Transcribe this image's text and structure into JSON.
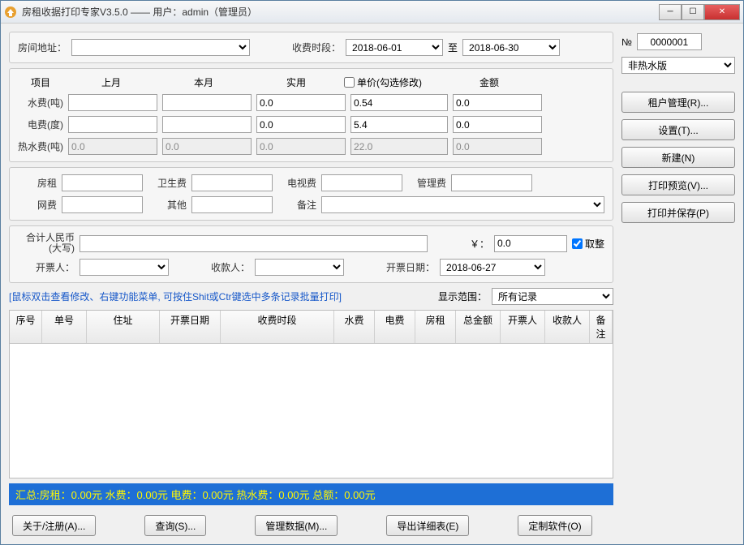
{
  "window": {
    "title": "房租收据打印专家V3.5.0 —— 用户：admin（管理员）"
  },
  "number": {
    "label": "№",
    "value": "0000001"
  },
  "address": {
    "label": "房间地址："
  },
  "period": {
    "label": "收费时段：",
    "from": "2018-06-01",
    "to_label": "至",
    "to": "2018-06-30"
  },
  "version_select": "非热水版",
  "cols": {
    "project": "项目",
    "last": "上月",
    "this": "本月",
    "usage": "实用",
    "price_chk": "单价(勾选修改)",
    "amount": "金额"
  },
  "rows": {
    "water": {
      "label": "水费(吨)",
      "usage": "0.0",
      "price": "0.54",
      "amount": "0.0"
    },
    "elec": {
      "label": "电费(度)",
      "usage": "0.0",
      "price": "5.4",
      "amount": "0.0"
    },
    "hot": {
      "label": "热水费(吨)",
      "last": "0.0",
      "this": "0.0",
      "usage": "0.0",
      "price": "22.0",
      "amount": "0.0"
    }
  },
  "fees": {
    "rent": "房租",
    "clean": "卫生费",
    "tv": "电视费",
    "manage": "管理费",
    "net": "网费",
    "other": "其他",
    "remark": "备注"
  },
  "total": {
    "label": "合计人民币(大写)",
    "yen": "￥：",
    "value": "0.0",
    "round_chk": "取整"
  },
  "issuer": {
    "label": "开票人：",
    "payee": "收款人：",
    "date_label": "开票日期：",
    "date": "2018-06-27"
  },
  "hint": "[鼠标双击查看修改、右键功能菜单, 可按住Shit或Ctr键选中多条记录批量打印]",
  "scope": {
    "label": "显示范围：",
    "value": "所有记录"
  },
  "table_headers": {
    "seq": "序号",
    "no": "单号",
    "addr": "住址",
    "date": "开票日期",
    "period": "收费时段",
    "water": "水费",
    "elec": "电费",
    "rent": "房租",
    "total": "总金额",
    "issuer": "开票人",
    "payee": "收款人",
    "remark": "备注"
  },
  "summary": "汇总:房租：0.00元   水费：0.00元   电费：0.00元   热水费：0.00元   总额：0.00元",
  "btns": {
    "tenant": "租户管理(R)...",
    "settings": "设置(T)...",
    "new": "新建(N)",
    "preview": "打印预览(V)...",
    "print_save": "打印并保存(P)",
    "about": "关于/注册(A)...",
    "query": "查询(S)...",
    "manage": "管理数据(M)...",
    "export": "导出详细表(E)",
    "custom": "定制软件(O)"
  }
}
